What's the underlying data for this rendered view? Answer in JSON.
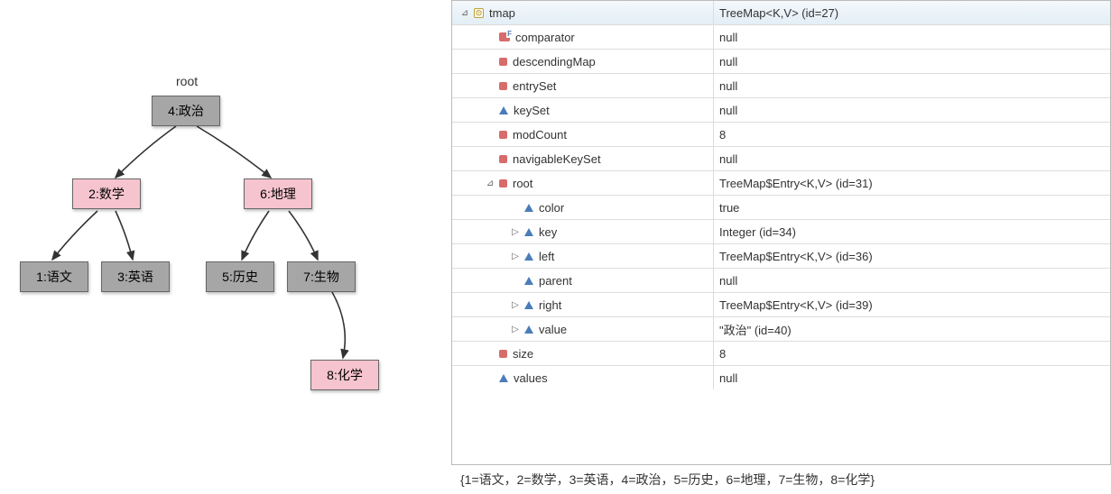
{
  "tree": {
    "root_label": "root",
    "nodes": {
      "n4": "4:政治",
      "n2": "2:数学",
      "n6": "6:地理",
      "n1": "1:语文",
      "n3": "3:英语",
      "n5": "5:历史",
      "n7": "7:生物",
      "n8": "8:化学"
    }
  },
  "debug": {
    "rows": [
      {
        "indent": 0,
        "expander": "⊿",
        "icon": "obj",
        "name": "tmap",
        "value": "TreeMap<K,V>  (id=27)",
        "header": true
      },
      {
        "indent": 1,
        "expander": "",
        "icon": "redF",
        "name": "comparator",
        "value": "null"
      },
      {
        "indent": 1,
        "expander": "",
        "icon": "red",
        "name": "descendingMap",
        "value": "null"
      },
      {
        "indent": 1,
        "expander": "",
        "icon": "red",
        "name": "entrySet",
        "value": "null"
      },
      {
        "indent": 1,
        "expander": "",
        "icon": "blue",
        "name": "keySet",
        "value": "null"
      },
      {
        "indent": 1,
        "expander": "",
        "icon": "red",
        "name": "modCount",
        "value": "8"
      },
      {
        "indent": 1,
        "expander": "",
        "icon": "red",
        "name": "navigableKeySet",
        "value": "null"
      },
      {
        "indent": 1,
        "expander": "⊿",
        "icon": "red",
        "name": "root",
        "value": "TreeMap$Entry<K,V>  (id=31)"
      },
      {
        "indent": 2,
        "expander": "",
        "icon": "blue",
        "name": "color",
        "value": "true"
      },
      {
        "indent": 2,
        "expander": "▷",
        "icon": "blue",
        "name": "key",
        "value": "Integer  (id=34)"
      },
      {
        "indent": 2,
        "expander": "▷",
        "icon": "blue",
        "name": "left",
        "value": "TreeMap$Entry<K,V>  (id=36)"
      },
      {
        "indent": 2,
        "expander": "",
        "icon": "blue",
        "name": "parent",
        "value": "null"
      },
      {
        "indent": 2,
        "expander": "▷",
        "icon": "blue",
        "name": "right",
        "value": "TreeMap$Entry<K,V>  (id=39)"
      },
      {
        "indent": 2,
        "expander": "▷",
        "icon": "blue",
        "name": "value",
        "value": "\"政治\" (id=40)"
      },
      {
        "indent": 1,
        "expander": "",
        "icon": "red",
        "name": "size",
        "value": "8"
      },
      {
        "indent": 1,
        "expander": "",
        "icon": "blue",
        "name": "values",
        "value": "null"
      }
    ]
  },
  "footer": "{1=语文，2=数学，3=英语，4=政治，5=历史，6=地理，7=生物，8=化学}"
}
